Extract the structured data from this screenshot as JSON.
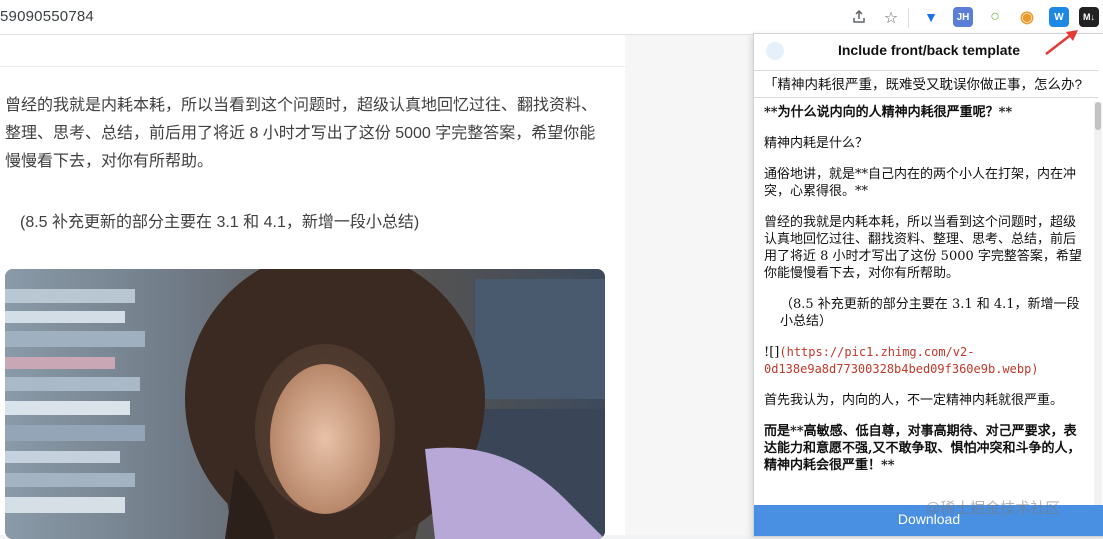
{
  "browser": {
    "url_fragment": "59090550784",
    "icons": [
      "share-icon",
      "star-icon"
    ],
    "extensions": [
      {
        "name": "vue-extension-icon",
        "label": "▼",
        "color": "#1a73e8"
      },
      {
        "name": "jh-extension-icon",
        "label": "JH",
        "color": "#5b7fd6"
      },
      {
        "name": "leaf-extension-icon",
        "label": "○",
        "color": "#7cb342"
      },
      {
        "name": "globe-extension-icon",
        "label": "◉",
        "color": "#e89a2c"
      },
      {
        "name": "w-extension-icon",
        "label": "W",
        "color": "#1e88e5"
      },
      {
        "name": "markdown-extension-icon",
        "label": "M↓",
        "color": "#222222"
      }
    ]
  },
  "article": {
    "paragraph": "曾经的我就是内耗本耗，所以当看到这个问题时，超级认真地回忆过往、翻找资料、整理、思考、总结，前后用了将近 8 小时才写出了这份 5000 字完整答案，希望你能慢慢看下去，对你有所帮助。",
    "note": "(8.5 补充更新的部分主要在 3.1 和 4.1，新增一段小总结)"
  },
  "popup": {
    "title": "Include front/back template",
    "input_value": "「精神内耗很严重，既难受又耽误你做正事，怎么办?",
    "content": {
      "heading": "**为什么说内向的人精神内耗很严重呢？**",
      "q1": "精神内耗是什么？",
      "p1": "通俗地讲，就是**自己内在的两个小人在打架，内在冲突，心累得很。**",
      "p2": "曾经的我就是内耗本耗，所以当看到这个问题时，超级认真地回忆过往、翻找资料、整理、思考、总结，前后用了将近 8 小时才写出了这份 5000 字完整答案，希望你能慢慢看下去，对你有所帮助。",
      "p3": "（8.5 补充更新的部分主要在 3.1 和 4.1，新增一段小总结）",
      "image_md_prefix": "![]",
      "image_md_link": "(https://pic1.zhimg.com/v2-0d138e9a8d77300328b4bed09f360e9b.webp)",
      "p4": "首先我认为，内向的人，不一定精神内耗就很严重。",
      "p5": "而是**高敏感、低自尊，对事高期待、对己严要求，表达能力和意愿不强,又不敢争取、惧怕冲突和斗争的人，精神内耗会很严重！**"
    },
    "download_label": "Download"
  },
  "watermark": "@稀土掘金技术社区"
}
